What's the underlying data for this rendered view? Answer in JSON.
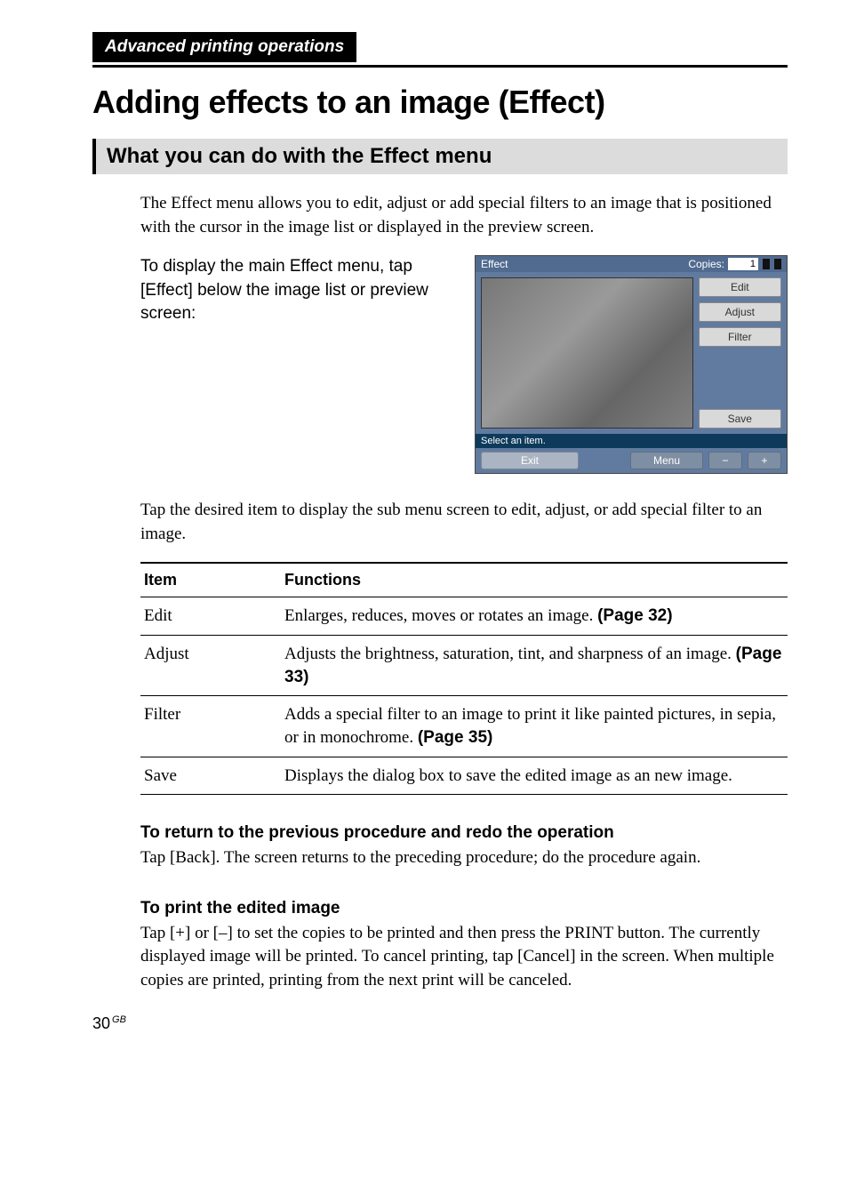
{
  "section_header": "Advanced printing operations",
  "title": "Adding effects to an image (Effect)",
  "subtitle": "What you can do with the Effect menu",
  "intro_para": "The Effect menu allows you to edit, adjust or add special filters to an image that is positioned with the cursor in the image list or displayed in the preview screen.",
  "lead_para": "To display the main Effect menu, tap [Effect] below the image list or preview screen:",
  "screenshot": {
    "titlebar": "Effect",
    "copies_label": "Copies:",
    "copies_value": "1",
    "side_buttons": [
      "Edit",
      "Adjust",
      "Filter",
      "Save"
    ],
    "status": "Select an item.",
    "bottom": {
      "exit": "Exit",
      "menu": "Menu",
      "minus": "−",
      "plus": "+"
    }
  },
  "after_shot_para": "Tap the desired item to display the sub menu screen to edit, adjust, or add special filter to an image.",
  "table": {
    "head": [
      "Item",
      "Functions"
    ],
    "rows": [
      {
        "item": "Edit",
        "func": "Enlarges, reduces, moves or rotates an image.",
        "page": "(Page 32)"
      },
      {
        "item": "Adjust",
        "func": "Adjusts the brightness, saturation, tint, and sharpness of an image.",
        "page": "(Page 33)"
      },
      {
        "item": "Filter",
        "func": "Adds a special filter to an image to print it like painted pictures, in sepia, or in monochrome.",
        "page": "(Page 35)"
      },
      {
        "item": "Save",
        "func": "Displays the dialog box to save the edited image as an new image.",
        "page": ""
      }
    ]
  },
  "sub1_h": "To return to the previous procedure and redo the operation",
  "sub1_p": "Tap [Back].  The screen returns to the preceding procedure;  do the procedure again.",
  "sub2_h": "To print the edited image",
  "sub2_p": "Tap [+] or [–] to set the copies to be printed and then press the PRINT button. The currently displayed image will be printed.  To cancel printing, tap [Cancel]  in the screen.  When multiple copies are printed, printing from the next print will be canceled.",
  "page_number": "30",
  "page_region": "GB"
}
